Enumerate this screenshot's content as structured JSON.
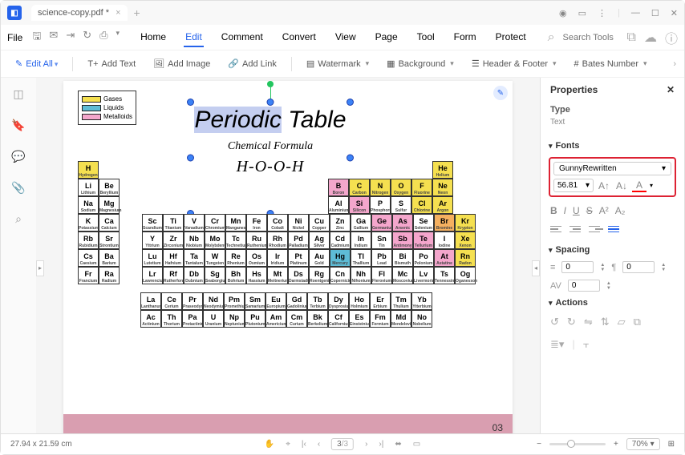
{
  "titlebar": {
    "filename": "science-copy.pdf *"
  },
  "menubar": {
    "file": "File",
    "items": [
      "Home",
      "Edit",
      "Comment",
      "Convert",
      "View",
      "Page",
      "Tool",
      "Form",
      "Protect"
    ],
    "active_index": 1,
    "search_placeholder": "Search Tools"
  },
  "toolbar": {
    "edit_all": "Edit All",
    "add_text": "Add Text",
    "add_image": "Add Image",
    "add_link": "Add Link",
    "watermark": "Watermark",
    "background": "Background",
    "header_footer": "Header & Footer",
    "bates": "Bates Number"
  },
  "document": {
    "legend": {
      "gases": "Gases",
      "liquids": "Liquids",
      "metalloids": "Metalloids"
    },
    "title_hl": "Periodic",
    "title_rest": " Table",
    "subtitle": "Chemical Formula",
    "formula": "H-O-O-H",
    "page_number": "03",
    "elements": {
      "r1": {
        "H": "Hydrogen",
        "He": "Helium"
      },
      "r2": {
        "Li": "Lithium",
        "Be": "Beryllium",
        "B": "Boron",
        "C": "Carbon",
        "N": "Nitrogen",
        "O": "Oxygen",
        "F": "Fluorine",
        "Ne": "Neon"
      },
      "r3": {
        "Na": "Sodium",
        "Mg": "Magnesium",
        "Al": "Aluminium",
        "Si": "Silicon",
        "P": "Phosphorus",
        "S": "Sulfur",
        "Cl": "Chlorine",
        "Ar": "Argon"
      },
      "r4": {
        "K": "Potassium",
        "Ca": "Calcium",
        "Sc": "Scandium",
        "Ti": "Titanium",
        "V": "Vanadium",
        "Cr": "Chromium",
        "Mn": "Manganese",
        "Fe": "Iron",
        "Co": "Cobalt",
        "Ni": "Nickel",
        "Cu": "Copper",
        "Zn": "Zinc",
        "Ga": "Gallium",
        "Ge": "Germanium",
        "As": "Arsenic",
        "Se": "Selenium",
        "Br": "Bromine",
        "Kr": "Krypton"
      },
      "r5": {
        "Rb": "Rubidium",
        "Sr": "Strontium",
        "Y": "Yttrium",
        "Zr": "Zirconium",
        "Nb": "Niobium",
        "Mo": "Molybdenum",
        "Tc": "Technetium",
        "Ru": "Ruthenium",
        "Rh": "Rhodium",
        "Pd": "Palladium",
        "Ag": "Silver",
        "Cd": "Cadmium",
        "In": "Indium",
        "Sn": "Tin",
        "Sb": "Antimony",
        "Te": "Tellurium",
        "I": "Iodine",
        "Xe": "Xenon"
      },
      "r6": {
        "Cs": "Caesium",
        "Ba": "Barium",
        "Lu": "Lutetium",
        "Hf": "Hafnium",
        "Ta": "Tantalum",
        "W": "Tungsten",
        "Re": "Rhenium",
        "Os": "Osmium",
        "Ir": "Iridium",
        "Pt": "Platinum",
        "Au": "Gold",
        "Hg": "Mercury",
        "Tl": "Thallium",
        "Pb": "Lead",
        "Bi": "Bismuth",
        "Po": "Polonium",
        "At": "Astatine",
        "Rn": "Radon"
      },
      "r7": {
        "Fr": "Francium",
        "Ra": "Radium",
        "Lr": "Lawrencium",
        "Rf": "Rutherfordium",
        "Db": "Dubnium",
        "Sg": "Seaborgium",
        "Bh": "Bohrium",
        "Hs": "Hassium",
        "Mt": "Meitnerium",
        "Ds": "Darmstadtium",
        "Rg": "Roentgenium",
        "Cn": "Copernicium",
        "Nh": "Nihonium",
        "Fl": "Flerovium",
        "Mc": "Moscovium",
        "Lv": "Livermorium",
        "Ts": "Tennessine",
        "Og": "Oganesson"
      },
      "rLa": {
        "La": "Lanthanum",
        "Ce": "Cerium",
        "Pr": "Praseodymium",
        "Nd": "Neodymium",
        "Pm": "Promethium",
        "Sm": "Samarium",
        "Eu": "Europium",
        "Gd": "Gadolinium",
        "Tb": "Terbium",
        "Dy": "Dysprosium",
        "Ho": "Holmium",
        "Er": "Erbium",
        "Tm": "Thulium",
        "Yb": "Ytterbium"
      },
      "rAc": {
        "Ac": "Actinium",
        "Th": "Thorium",
        "Pa": "Protactinium",
        "U": "Uranium",
        "Np": "Neptunium",
        "Pu": "Plutonium",
        "Am": "Americium",
        "Cm": "Curium",
        "Bk": "Berkelium",
        "Cf": "Californium",
        "Es": "Einsteinium",
        "Fm": "Fermium",
        "Md": "Mendelevium",
        "No": "Nobelium"
      }
    }
  },
  "panel": {
    "title": "Properties",
    "type_label": "Type",
    "type_value": "Text",
    "fonts_label": "Fonts",
    "font_family": "GunnyRewritten",
    "font_size": "56.81",
    "spacing_label": "Spacing",
    "spacing_val1": "0",
    "spacing_val2": "0",
    "spacing_val3": "0",
    "actions_label": "Actions"
  },
  "statusbar": {
    "dimensions": "27.94 x 21.59 cm",
    "page_current": "3",
    "page_total": "/3",
    "zoom": "70%"
  }
}
